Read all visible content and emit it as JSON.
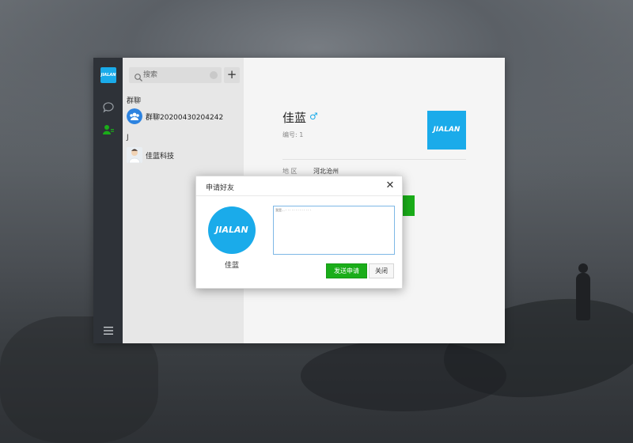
{
  "app": {
    "logo_text": "JIALAN",
    "nav": {
      "chat_icon": "chat-bubble-icon",
      "contacts_icon": "contacts-icon",
      "menu_icon": "hamburger-menu-icon"
    },
    "accent_color": "#1aad19",
    "brand_color": "#1aabea"
  },
  "contacts_panel": {
    "search": {
      "placeholder": "搜索",
      "value": ""
    },
    "add_label": "+",
    "sections": [
      {
        "header": "群聊",
        "items": [
          {
            "name": "群聊20200430204242",
            "avatar": "group-avatar-icon"
          }
        ]
      },
      {
        "header": "J",
        "items": [
          {
            "name": "佳蓝科技",
            "avatar": "user-avatar"
          }
        ]
      }
    ]
  },
  "profile": {
    "name": "佳蓝",
    "gender_symbol": "♂",
    "id_text": "编号: 1",
    "logo_text": "JIALAN",
    "region_label": "地 区",
    "region_value": "河北沧州"
  },
  "friend_request_dialog": {
    "title": "申请好友",
    "close_symbol": "✕",
    "avatar_text": "JIALAN",
    "name": "佳蓝",
    "message_value": "我是... · · · · · · · · · · · · ·",
    "send_label": "发送申请",
    "close_label": "关闭"
  }
}
